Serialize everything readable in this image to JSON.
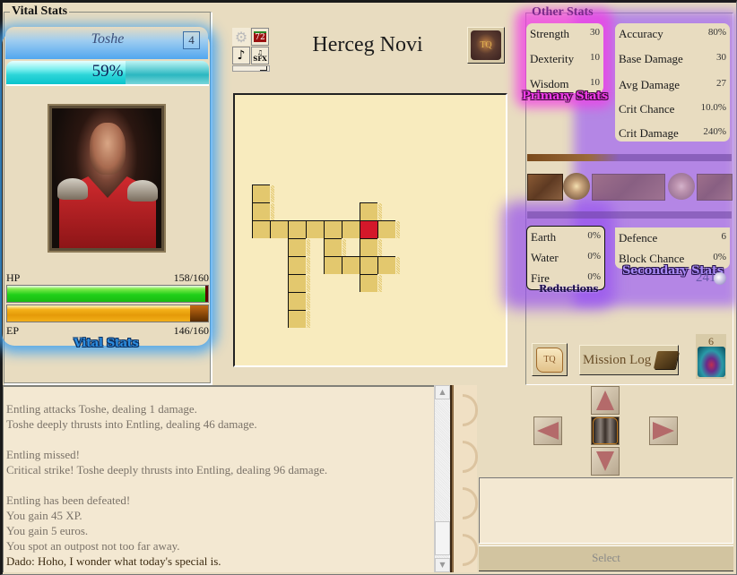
{
  "vital_stats": {
    "legend": "Vital Stats",
    "character_name": "Toshe",
    "level": "4",
    "xp_percent_label": "59%",
    "xp_fraction": 0.59,
    "hp_label": "HP",
    "hp_value": "158/160",
    "hp_current": 158,
    "hp_max": 160,
    "ep_label": "EP",
    "ep_value": "146/160",
    "ep_current": 146,
    "ep_max": 160,
    "overlay_tag": "Vital Stats"
  },
  "toolbar": {
    "settings_icon": "gear-icon",
    "day_counter": "72",
    "music_icon": "music-note-icon",
    "sfx_label": "SFX"
  },
  "location": {
    "title": "Herceg Novi",
    "quest_button_label": "TQ"
  },
  "map": {
    "cells": [
      [
        0,
        0
      ],
      [
        0,
        1
      ],
      [
        6,
        1
      ],
      [
        0,
        2
      ],
      [
        1,
        2
      ],
      [
        2,
        2
      ],
      [
        3,
        2
      ],
      [
        4,
        2
      ],
      [
        5,
        2
      ],
      [
        6,
        2
      ],
      [
        7,
        2
      ],
      [
        2,
        3
      ],
      [
        4,
        3
      ],
      [
        6,
        3
      ],
      [
        2,
        4
      ],
      [
        4,
        4
      ],
      [
        5,
        4
      ],
      [
        6,
        4
      ],
      [
        7,
        4
      ],
      [
        2,
        5
      ],
      [
        6,
        5
      ],
      [
        2,
        6
      ],
      [
        2,
        7
      ]
    ],
    "current_cell": [
      6,
      2
    ]
  },
  "other_stats": {
    "legend": "Other Stats",
    "primary": [
      {
        "label": "Strength",
        "value": "30"
      },
      {
        "label": "Dexterity",
        "value": "10"
      },
      {
        "label": "Wisdom",
        "value": "10"
      }
    ],
    "primary_tag": "Primary Stats",
    "combat": [
      {
        "label": "Accuracy",
        "value": "80%"
      },
      {
        "label": "Base Damage",
        "value": "30"
      },
      {
        "label": "Avg Damage",
        "value": "27"
      },
      {
        "label": "Crit Chance",
        "value": "10.0%"
      },
      {
        "label": "Crit Damage",
        "value": "240%"
      }
    ],
    "reductions": [
      {
        "label": "Earth",
        "value": "0%"
      },
      {
        "label": "Water",
        "value": "0%"
      },
      {
        "label": "Fire",
        "value": "0%"
      }
    ],
    "reductions_tag": "Reductions",
    "secondary": [
      {
        "label": "Defence",
        "value": "6"
      },
      {
        "label": "Block Chance",
        "value": "0%"
      }
    ],
    "secondary_tag": "Secondary Stats",
    "money": "241",
    "scroll_button_label": "TQ",
    "mission_log_label": "Mission Log",
    "potion_count": "6"
  },
  "log": {
    "lines": [
      {
        "text": "Entling attacks Toshe, dealing 1 damage.",
        "type": "normal"
      },
      {
        "text": "Toshe deeply thrusts into Entling, dealing 46 damage.",
        "type": "normal"
      },
      {
        "text": "",
        "type": "blank"
      },
      {
        "text": "Entling missed!",
        "type": "normal"
      },
      {
        "text": "Critical strike! Toshe deeply thrusts into Entling, dealing 96 damage.",
        "type": "normal"
      },
      {
        "text": "",
        "type": "blank"
      },
      {
        "text": "Entling has been defeated!",
        "type": "normal"
      },
      {
        "text": "You gain 45 XP.",
        "type": "normal"
      },
      {
        "text": "You gain 5 euros.",
        "type": "normal"
      },
      {
        "text": "You spot an outpost not too far away.",
        "type": "normal"
      },
      {
        "text": "Dado: Hoho, I wonder what today's special is.",
        "type": "npc"
      }
    ]
  },
  "navigation": {
    "up": "move-north",
    "down": "move-south",
    "left": "move-west",
    "right": "move-east",
    "center": "equipment"
  },
  "select": {
    "button_label": "Select"
  }
}
